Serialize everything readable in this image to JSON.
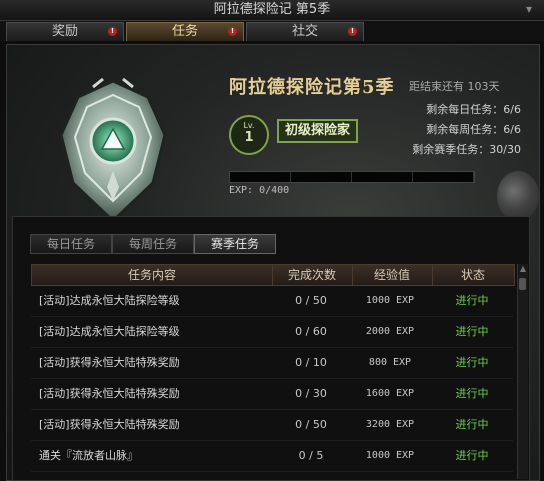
{
  "window": {
    "title": "阿拉德探险记 第5季"
  },
  "main_tabs": [
    {
      "label": "奖励",
      "badge": "!",
      "active": false
    },
    {
      "label": "任务",
      "badge": "!",
      "active": true
    },
    {
      "label": "社交",
      "badge": "!",
      "active": false
    }
  ],
  "season": {
    "title": "阿拉德探险记第5季",
    "countdown": "距结束还有 103天",
    "level_label": "Lv.",
    "level_value": "1",
    "rank": "初级探险家",
    "remaining_daily": "剩余每日任务：6/6",
    "remaining_weekly": "剩余每周任务：6/6",
    "remaining_season": "剩余赛季任务：30/30",
    "exp_text": "EXP: 0/400",
    "exp_progress": 0
  },
  "sub_tabs": [
    {
      "label": "每日任务",
      "active": false
    },
    {
      "label": "每周任务",
      "active": false
    },
    {
      "label": "赛季任务",
      "active": true
    }
  ],
  "table": {
    "headers": [
      "任务内容",
      "完成次数",
      "经验值",
      "状态"
    ],
    "rows": [
      {
        "name": "[活动]达成永恒大陆探险等级",
        "count": "0 / 50",
        "exp": "1000 EXP",
        "status": "进行中"
      },
      {
        "name": "[活动]达成永恒大陆探险等级",
        "count": "0 / 60",
        "exp": "2000 EXP",
        "status": "进行中"
      },
      {
        "name": "[活动]获得永恒大陆特殊奖励",
        "count": "0 / 10",
        "exp": "800 EXP",
        "status": "进行中"
      },
      {
        "name": "[活动]获得永恒大陆特殊奖励",
        "count": "0 / 30",
        "exp": "1600 EXP",
        "status": "进行中"
      },
      {
        "name": "[活动]获得永恒大陆特殊奖励",
        "count": "0 / 50",
        "exp": "3200 EXP",
        "status": "进行中"
      },
      {
        "name": "通关『流放者山脉』",
        "count": "0 / 5",
        "exp": "1000 EXP",
        "status": "进行中"
      }
    ]
  },
  "colors": {
    "accent_gold": "#e6cf95",
    "status_green": "#6ccf4a",
    "badge_red": "#c0201c"
  }
}
